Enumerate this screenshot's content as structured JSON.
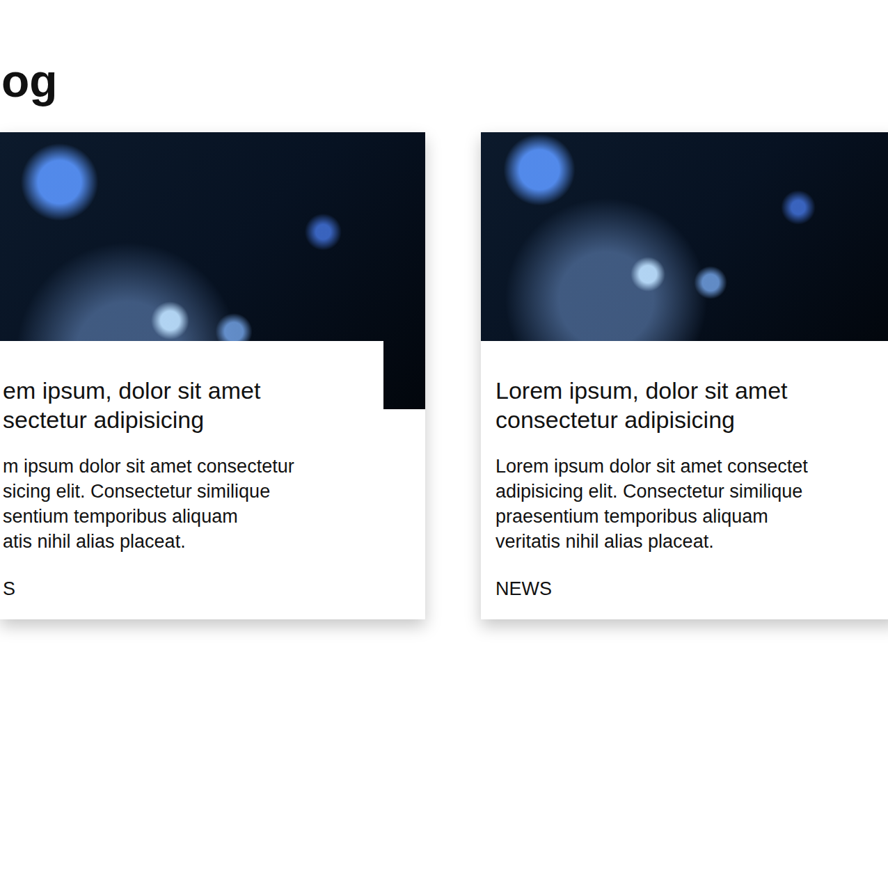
{
  "section": {
    "title": "og"
  },
  "cards": [
    {
      "title_lines": [
        "em ipsum, dolor sit amet",
        "sectetur adipisicing"
      ],
      "body_lines": [
        "m ipsum dolor sit amet consectetur",
        "sicing elit. Consectetur similique",
        "sentium temporibus aliquam",
        "atis nihil alias placeat."
      ],
      "tag": "S",
      "hovered": true,
      "cut_left": true
    },
    {
      "title_lines": [
        "Lorem ipsum, dolor sit amet",
        "consectetur adipisicing"
      ],
      "body_lines": [
        "Lorem ipsum dolor sit amet consectet",
        "adipisicing elit. Consectetur similique",
        "praesentium temporibus aliquam",
        "veritatis nihil alias placeat."
      ],
      "tag": "NEWS",
      "hovered": false,
      "cut_left": false
    }
  ]
}
